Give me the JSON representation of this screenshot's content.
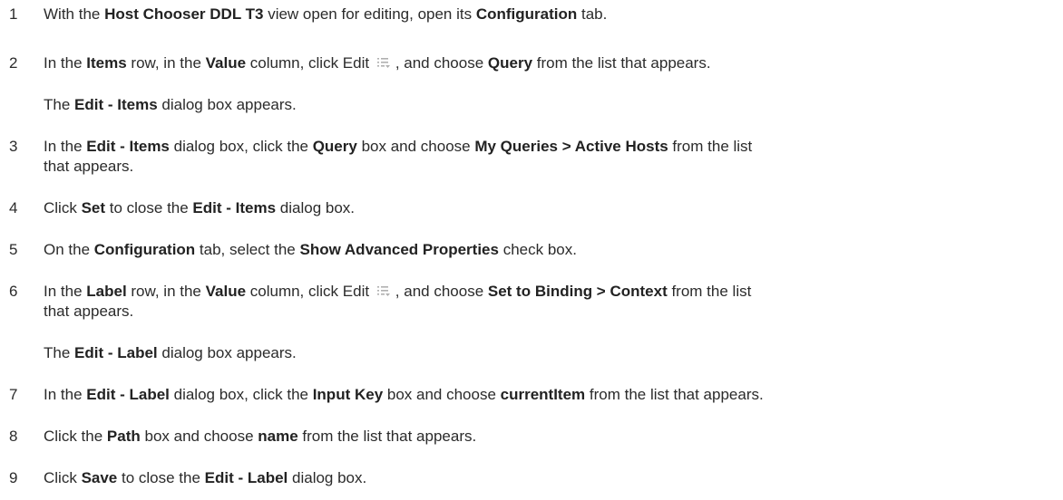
{
  "steps": [
    {
      "num": "1",
      "parts": [
        "With the ",
        "Host Chooser DDL T3",
        " view open for editing, open its ",
        "Configuration",
        " tab."
      ]
    },
    {
      "num": "2",
      "parts": [
        "In the ",
        "Items",
        " row, in the ",
        "Value",
        " column, click Edit ",
        "",
        ", and choose ",
        "Query",
        " from the list that appears."
      ]
    },
    {
      "note": [
        "The ",
        "Edit - Items",
        " dialog box appears."
      ]
    },
    {
      "num": "3",
      "lines": [
        [
          "In the ",
          "Edit - Items",
          " dialog box, click the ",
          "Query",
          " box and choose ",
          "My Queries > Active Hosts",
          " from the list"
        ],
        [
          "that appears."
        ]
      ]
    },
    {
      "num": "4",
      "parts": [
        "Click ",
        "Set",
        " to close the ",
        "Edit - Items",
        " dialog box."
      ]
    },
    {
      "num": "5",
      "parts": [
        "On the ",
        "Configuration",
        " tab, select the ",
        "Show Advanced Properties",
        " check box."
      ]
    },
    {
      "num": "6",
      "lines": [
        [
          "In the ",
          "Label",
          " row, in the ",
          "Value",
          " column, click Edit ",
          "",
          ", and choose ",
          "Set to Binding > Context",
          " from the list"
        ],
        [
          "that appears."
        ]
      ]
    },
    {
      "note": [
        "The ",
        "Edit - Label",
        " dialog box appears."
      ]
    },
    {
      "num": "7",
      "parts": [
        "In the ",
        "Edit - Label",
        " dialog box, click the ",
        "Input Key",
        " box and choose ",
        "currentItem",
        " from the list that appears."
      ]
    },
    {
      "num": "8",
      "parts": [
        "Click the ",
        "Path",
        " box and choose ",
        "name",
        " from the list that appears."
      ]
    },
    {
      "num": "9",
      "parts": [
        "Click ",
        "Save",
        " to close the ",
        "Edit - Label",
        " dialog box."
      ]
    }
  ],
  "icons": {
    "edit": "edit-list-icon"
  }
}
